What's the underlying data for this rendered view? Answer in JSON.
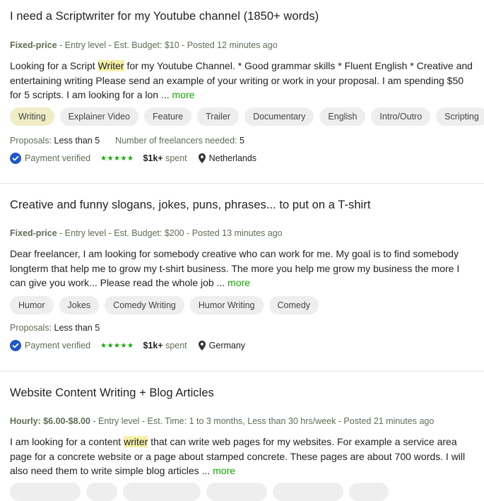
{
  "jobs": [
    {
      "title": "I need a Scriptwriter for my Youtube channel (1850+ words)",
      "kind": "Fixed-price",
      "meta_rest": " - Entry level - Est. Budget: $10 - Posted 12 minutes ago",
      "desc_pre": "Looking for a Script ",
      "desc_hl": "Writer",
      "desc_post": " for my Youtube Channel. * Good grammar skills * Fluent English * Creative and entertaining writing Please send an example of your writing or work in your proposal. I am spending $50 for 5 scripts. I am looking for a lon ... ",
      "more": "more",
      "tags": [
        "Writing",
        "Explainer Video",
        "Feature",
        "Trailer",
        "Documentary",
        "English",
        "Intro/Outro",
        "Scripting"
      ],
      "proposals_label": "Proposals: ",
      "proposals_value": "Less than 5",
      "needed_label": "Number of freelancers needed: ",
      "needed_value": "5",
      "payment": "Payment verified",
      "stars": "★★★★★",
      "spent_value": "$1k+",
      "spent_label": " spent",
      "location": "Netherlands"
    },
    {
      "title": "Creative and funny slogans, jokes, puns, phrases... to put on a T-shirt",
      "kind": "Fixed-price",
      "meta_rest": " - Entry level - Est. Budget: $200 - Posted 13 minutes ago",
      "desc_pre": "Dear freelancer, I am looking for somebody creative who can work for me. My goal is to find somebody longterm that help me to grow my t-shirt business. The more you help me grow my business the more I can give you work... Please read the whole job ... ",
      "more": "more",
      "tags": [
        "Humor",
        "Jokes",
        "Comedy Writing",
        "Humor Writing",
        "Comedy"
      ],
      "proposals_label": "Proposals: ",
      "proposals_value": "Less than 5",
      "payment": "Payment verified",
      "stars": "★★★★★",
      "spent_value": "$1k+",
      "spent_label": " spent",
      "location": "Germany"
    },
    {
      "title": "Website Content Writing + Blog Articles",
      "kind": "Hourly: $6.00-$8.00",
      "meta_rest": " - Entry level - Est. Time: 1 to 3 months, Less than 30 hrs/week - Posted 21 minutes ago",
      "desc_pre": "I am looking for a content ",
      "desc_hl": "writer",
      "desc_post": " that can write web pages for my websites. For example a service area page for a concrete website or a page about stamped concrete. These pages are about 700 words. I will also need them to write simple blog articles ... ",
      "more": "more"
    }
  ],
  "colors": {
    "accent": "#14a800",
    "verified": "#1f57c3",
    "highlight": "#f5f0a8"
  }
}
